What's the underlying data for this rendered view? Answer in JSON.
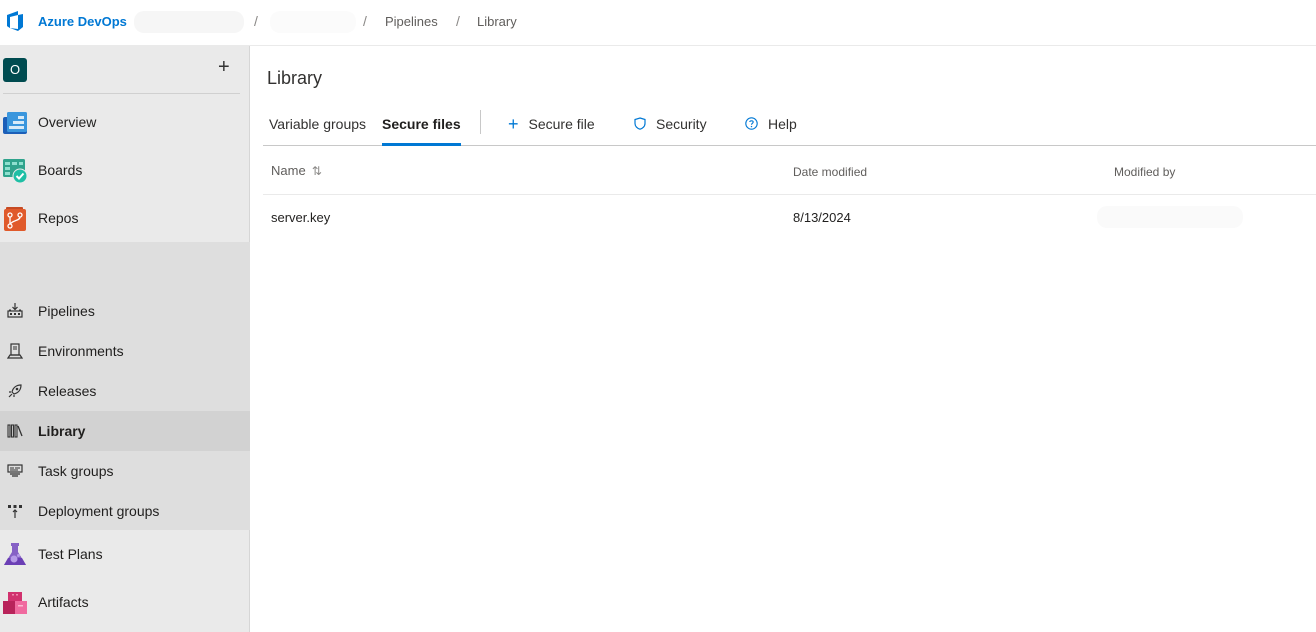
{
  "header": {
    "brand": "Azure DevOps",
    "breadcrumb": [
      {
        "label": "",
        "redacted": true
      },
      {
        "label": "",
        "redacted": true
      },
      {
        "label": "Pipelines"
      },
      {
        "label": "Library"
      }
    ],
    "separator": "/"
  },
  "sidebar": {
    "org_initial": "O",
    "add_label": "+",
    "items": [
      {
        "label": "Overview",
        "icon": "overview-icon"
      },
      {
        "label": "Boards",
        "icon": "boards-icon"
      },
      {
        "label": "Repos",
        "icon": "repos-icon"
      },
      {
        "label": "Pipelines",
        "icon": "pipelines-icon"
      },
      {
        "label": "Test Plans",
        "icon": "test-plans-icon"
      },
      {
        "label": "Artifacts",
        "icon": "artifacts-icon"
      }
    ],
    "sub_items": [
      {
        "label": "Pipelines",
        "icon": "pipelines-sub-icon"
      },
      {
        "label": "Environments",
        "icon": "environments-icon"
      },
      {
        "label": "Releases",
        "icon": "releases-icon"
      },
      {
        "label": "Library",
        "icon": "library-icon",
        "selected": true
      },
      {
        "label": "Task groups",
        "icon": "task-groups-icon"
      },
      {
        "label": "Deployment groups",
        "icon": "deployment-groups-icon"
      }
    ]
  },
  "main": {
    "title": "Library",
    "tabs": [
      {
        "label": "Variable groups",
        "active": false
      },
      {
        "label": "Secure files",
        "active": true
      }
    ],
    "commands": [
      {
        "label": "Secure file",
        "icon": "plus-icon",
        "glyph": "+"
      },
      {
        "label": "Security",
        "icon": "shield-icon",
        "glyph": "⛉"
      },
      {
        "label": "Help",
        "icon": "help-icon",
        "glyph": "?"
      }
    ],
    "table": {
      "columns": [
        "Name",
        "Date modified",
        "Modified by"
      ],
      "sort_glyph": "⇅",
      "rows": [
        {
          "name": "server.key",
          "date_modified": "8/13/2024",
          "modified_by": ""
        }
      ]
    }
  },
  "colors": {
    "accent": "#0078d4",
    "sidebar_bg": "#eaeaea",
    "subgroup_bg": "#dedede",
    "selected_bg": "#d2d2d2"
  }
}
